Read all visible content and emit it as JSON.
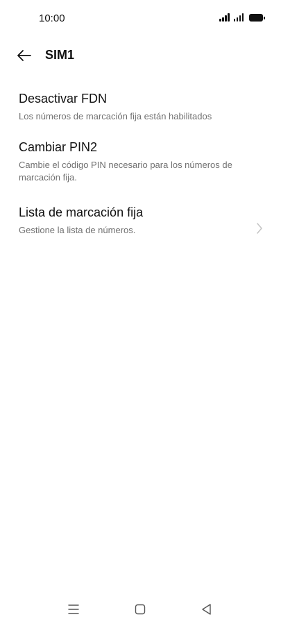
{
  "status_bar": {
    "time": "10:00",
    "icons": [
      "signal-sim1-icon",
      "signal-sim2-icon",
      "battery-icon"
    ]
  },
  "header": {
    "back_icon": "arrow-left-icon",
    "title": "SIM1"
  },
  "settings": {
    "items": [
      {
        "title": "Desactivar FDN",
        "subtitle": "Los números de marcación fija están habilitados"
      },
      {
        "title": "Cambiar PIN2",
        "subtitle": "Cambie el código PIN necesario para los números de marcación fija."
      },
      {
        "title": "Lista de marcación fija",
        "subtitle": "Gestione la lista de números.",
        "trailing_icon": "chevron-right-icon"
      }
    ]
  },
  "nav_bar": {
    "icons": [
      "menu-icon",
      "home-icon",
      "back-triangle-icon"
    ]
  },
  "colors": {
    "background": "#ffffff",
    "primary_text": "#111111",
    "secondary_text": "#707070",
    "chevron": "#c4c4c4"
  }
}
